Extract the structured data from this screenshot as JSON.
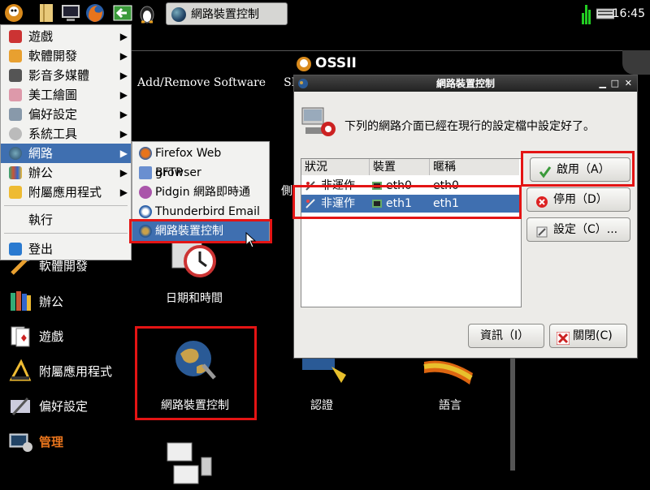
{
  "panel": {
    "task_label": "網路裝置控制",
    "clock": "16:45",
    "icons": [
      "ossii-menu-icon",
      "file-manager-icon",
      "terminal-icon",
      "firefox-icon",
      "green-arrow-icon",
      "penguin-icon"
    ]
  },
  "background": {
    "brand": "OSSII",
    "menu_items": [
      "Add/Remove Software",
      "SELi"
    ],
    "side_items": [
      {
        "label": "軟體開發",
        "icon": "development-icon"
      },
      {
        "label": "辦公",
        "icon": "office-icon"
      },
      {
        "label": "遊戲",
        "icon": "games-icon"
      },
      {
        "label": "附屬應用程式",
        "icon": "accessories-icon"
      },
      {
        "label": "偏好設定",
        "icon": "preferences-icon"
      },
      {
        "label": "管理",
        "icon": "admin-icon"
      }
    ],
    "grid_labels": [
      "日期和時間",
      "網路裝置控制",
      "認證",
      "語言"
    ],
    "partial_text": "側"
  },
  "start_menu": {
    "items": [
      {
        "label": "遊戲",
        "icon": "games-icon",
        "has_sub": true
      },
      {
        "label": "軟體開發",
        "icon": "development-icon",
        "has_sub": true
      },
      {
        "label": "影音多媒體",
        "icon": "multimedia-icon",
        "has_sub": true
      },
      {
        "label": "美工繪圖",
        "icon": "graphics-icon",
        "has_sub": true
      },
      {
        "label": "偏好設定",
        "icon": "preferences-icon",
        "has_sub": true
      },
      {
        "label": "系統工具",
        "icon": "system-tools-icon",
        "has_sub": true
      },
      {
        "label": "網路",
        "icon": "network-icon",
        "has_sub": true,
        "selected": true
      },
      {
        "label": "辦公",
        "icon": "office-icon",
        "has_sub": true
      },
      {
        "label": "附屬應用程式",
        "icon": "accessories-icon",
        "has_sub": true
      }
    ],
    "run": "執行",
    "logout": "登出"
  },
  "submenu": {
    "items": [
      {
        "label": "Firefox Web Browser",
        "icon": "firefox-icon"
      },
      {
        "label": "gFTP",
        "icon": "ftp-icon"
      },
      {
        "label": "Pidgin 網路即時通",
        "icon": "pidgin-icon"
      },
      {
        "label": "Thunderbird Email",
        "icon": "thunderbird-icon"
      },
      {
        "label": "網路裝置控制",
        "icon": "network-device-icon",
        "selected": true
      }
    ]
  },
  "dialog": {
    "title": "網路裝置控制",
    "message": "下列的網路介面已經在現行的設定檔中設定好了。",
    "columns": [
      "狀況",
      "裝置",
      "暱稱"
    ],
    "rows": [
      {
        "status": "非運作",
        "device": "eth0",
        "nickname": "eth0",
        "selected": false
      },
      {
        "status": "非運作",
        "device": "eth1",
        "nickname": "eth1",
        "selected": true
      }
    ],
    "buttons": {
      "activate": "啟用（A）",
      "deactivate": "停用（D）",
      "configure": "設定（C）...",
      "info": "資訊（I）",
      "close": "關閉(C)"
    }
  }
}
